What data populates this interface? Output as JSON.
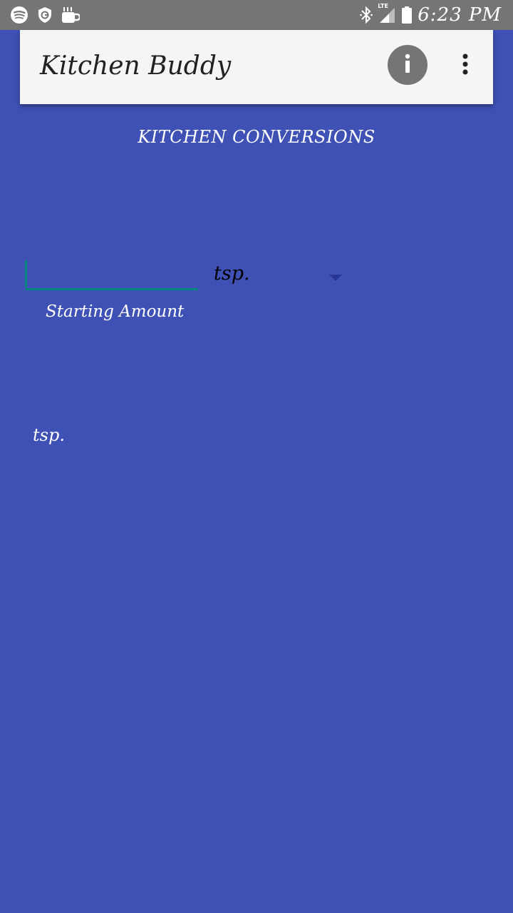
{
  "status_bar": {
    "time": "6:23 PM",
    "network_label": "LTE",
    "icons": [
      "spotify-icon",
      "vpn-shield-icon",
      "coffee-cup-icon",
      "bluetooth-icon",
      "cell-signal-icon",
      "battery-icon"
    ]
  },
  "app_bar": {
    "title": "Kitchen Buddy",
    "info_icon": "info-icon",
    "overflow_icon": "more-vert-icon"
  },
  "main": {
    "section_title": "KITCHEN CONVERSIONS",
    "amount_input": {
      "value": "",
      "label": "Starting Amount"
    },
    "unit_select": {
      "selected": "tsp."
    },
    "result_unit": "tsp."
  },
  "colors": {
    "background": "#3f51b5",
    "status_bar": "#757575",
    "app_bar": "#f5f5f5",
    "accent": "#00897b",
    "info_button": "#757575"
  }
}
